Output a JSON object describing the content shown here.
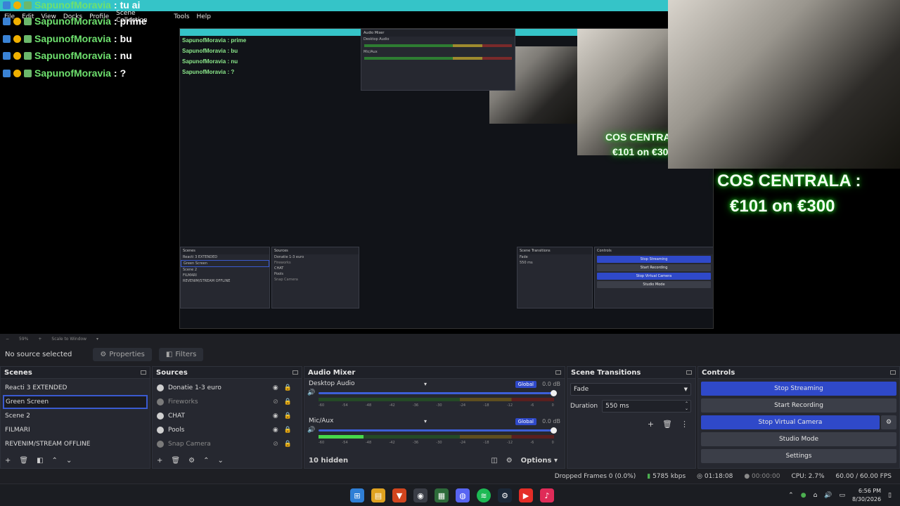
{
  "colors": {
    "accent": "#2f49c9",
    "chat_user": "#6ee06e",
    "glow": "#1fd31f",
    "titlebar": "#35c4c8"
  },
  "menu": [
    "File",
    "Edit",
    "View",
    "Docks",
    "Profile",
    "Scene Collection",
    "Tools",
    "Help"
  ],
  "chat": [
    {
      "user": "SapunofMoravia",
      "msg": "tu ai"
    },
    {
      "user": "SapunofMoravia",
      "msg": "prime"
    },
    {
      "user": "SapunofMoravia",
      "msg": "bu"
    },
    {
      "user": "SapunofMoravia",
      "msg": "nu"
    },
    {
      "user": "SapunofMoravia",
      "msg": "?"
    }
  ],
  "chat_sep": ":",
  "overlay": {
    "line1": "COS CENTRALA :",
    "line2": "€101 on €300"
  },
  "preview_bar": {
    "zoom": "59%",
    "scale": "Scale to Window"
  },
  "source_bar": {
    "no_source": "No source selected",
    "properties": "Properties",
    "filters": "Filters"
  },
  "scenes": {
    "title": "Scenes",
    "items": [
      "Reacti 3 EXTENDED",
      "Green Screen",
      "Scene 2",
      "FILMARI",
      "REVENIM/STREAM OFFLINE"
    ]
  },
  "sources": {
    "title": "Sources",
    "items": [
      "Donatie 1-3 euro",
      "Fireworks",
      "CHAT",
      "Pools",
      "Snap Camera"
    ]
  },
  "mixer": {
    "title": "Audio Mixer",
    "channels": [
      {
        "name": "Desktop Audio",
        "badge": "Global",
        "db": "0.0 dB",
        "level": 0
      },
      {
        "name": "Mic/Aux",
        "badge": "Global",
        "db": "0.0 dB",
        "level": 0.19
      }
    ],
    "ticks": [
      "-60",
      "-54",
      "-48",
      "-42",
      "-36",
      "-30",
      "-24",
      "-18",
      "-12",
      "-6",
      "0"
    ],
    "hidden": "10 hidden",
    "options": "Options"
  },
  "transitions": {
    "title": "Scene Transitions",
    "type": "Fade",
    "duration_label": "Duration",
    "duration": "550 ms"
  },
  "controls": {
    "title": "Controls",
    "stop_streaming": "Stop Streaming",
    "start_recording": "Start Recording",
    "stop_virtual_camera": "Stop Virtual Camera",
    "studio_mode": "Studio Mode",
    "settings": "Settings"
  },
  "status": {
    "dropped": "Dropped Frames 0 (0.0%)",
    "bitrate": "5785 kbps",
    "stream_time": "01:18:08",
    "rec_time": "00:00:00",
    "cpu": "CPU: 2.7%",
    "fps": "60.00 / 60.00 FPS"
  },
  "taskbar": {
    "time": "6:56 PM",
    "date": "8/30/2026"
  }
}
